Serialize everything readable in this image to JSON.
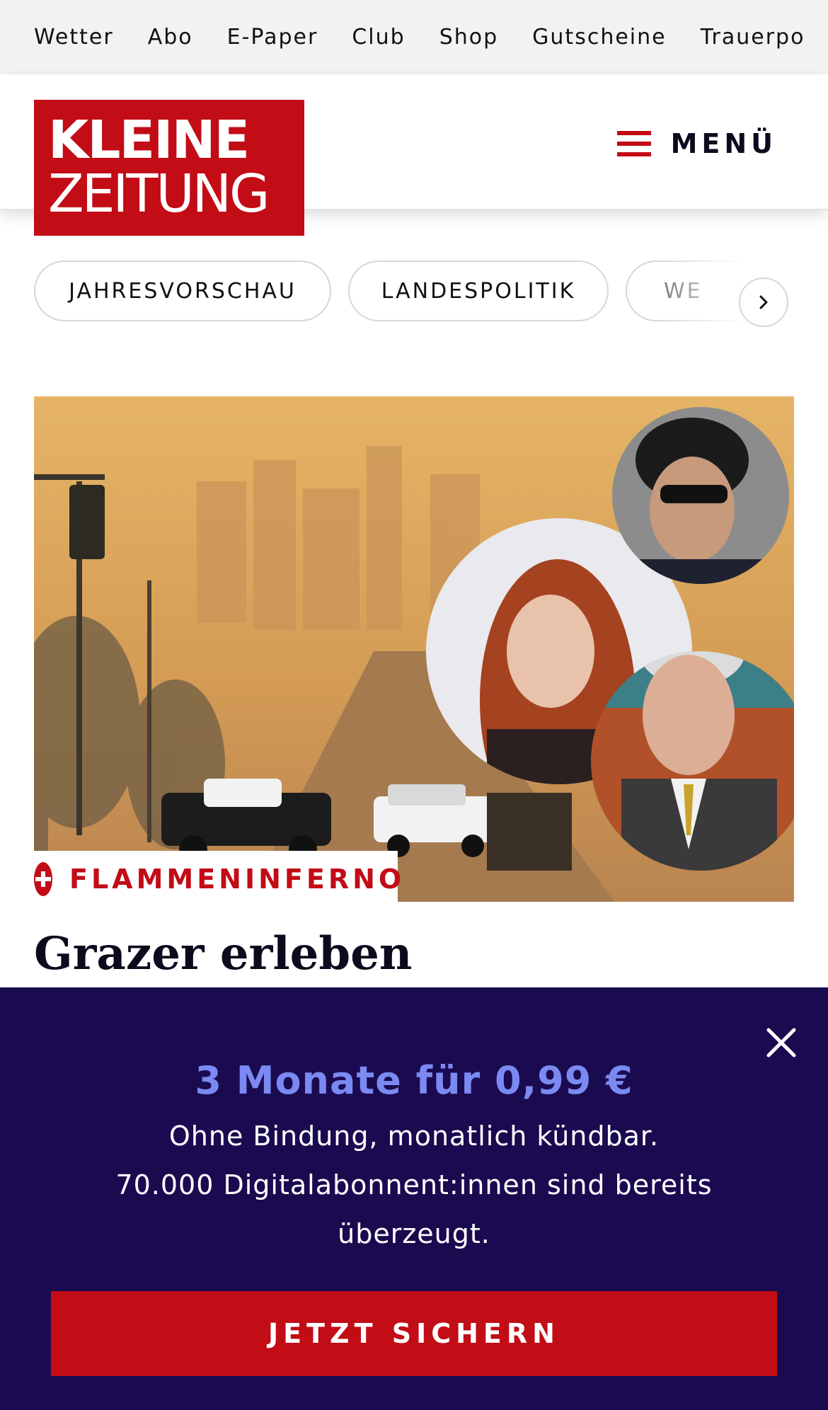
{
  "service_nav": {
    "items": [
      "Wetter",
      "Abo",
      "E-Paper",
      "Club",
      "Shop",
      "Gutscheine",
      "Trauerpo"
    ]
  },
  "header": {
    "logo_line1": "KLEINE",
    "logo_line2": "ZEITUNG",
    "menu_label": "MENÜ"
  },
  "topics": {
    "pills": [
      "JAHRESVORSCHAU",
      "LANDESPOLITIK",
      "WE"
    ]
  },
  "article": {
    "kicker": "FLAMMENINFERNO",
    "headline": "Grazer erleben „apokalyptische"
  },
  "paywall": {
    "offer": "3 Monate für 0,99 €",
    "line1": "Ohne Bindung, monatlich kündbar.",
    "line2": "70.000 Digitalabonnent:innen sind bereits überzeugt.",
    "cta": "JETZT SICHERN"
  },
  "colors": {
    "brand_red": "#c20c16",
    "paywall_bg": "#1a0b50",
    "offer_blue": "#7b8af2"
  },
  "icons": {
    "menu": "hamburger-icon",
    "next": "chevron-right-icon",
    "kicker": "plus-icon",
    "close": "close-icon"
  }
}
